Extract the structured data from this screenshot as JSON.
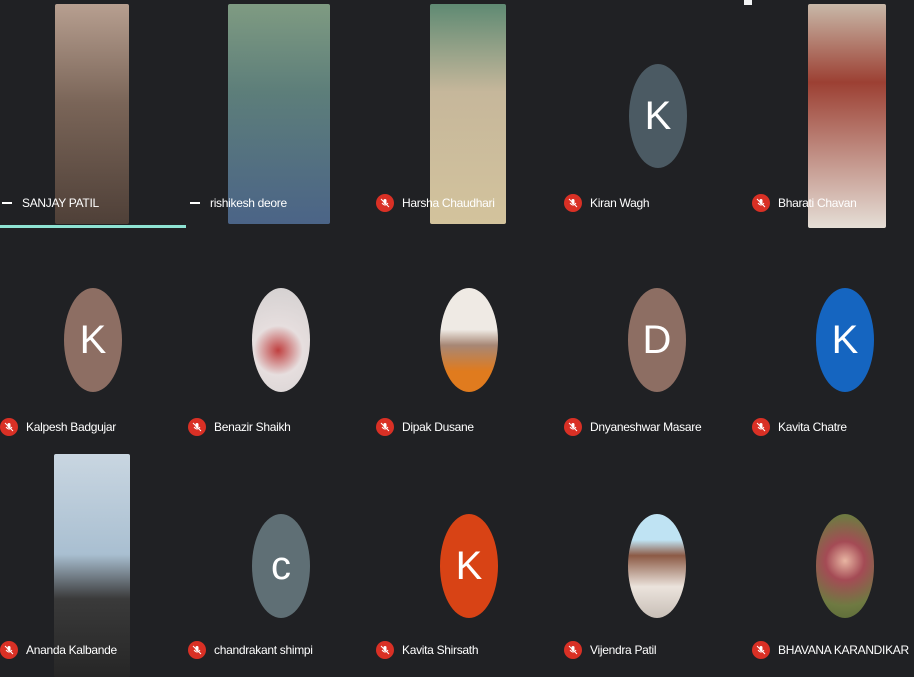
{
  "meeting": {
    "participants": [
      {
        "name": "SANJAY PATIL",
        "type": "video",
        "mic": "on",
        "bg": "#6b5a4f"
      },
      {
        "name": "rishikesh deore",
        "type": "video",
        "mic": "on",
        "bg": "#6b8a6a"
      },
      {
        "name": "Harsha Chaudhari",
        "type": "video",
        "mic": "muted",
        "bg": "#b9a98a"
      },
      {
        "name": "Kiran Wagh",
        "type": "letter",
        "letter": "K",
        "mic": "muted",
        "color": "#4b5a63"
      },
      {
        "name": "Bharati Chavan",
        "type": "video",
        "mic": "muted",
        "bg": "#9c4033"
      },
      {
        "name": "Kalpesh Badgujar",
        "type": "letter",
        "letter": "K",
        "mic": "muted",
        "color": "#8d6e63"
      },
      {
        "name": "Benazir Shaikh",
        "type": "photo",
        "mic": "muted",
        "color": "#d9d4d2"
      },
      {
        "name": "Dipak Dusane",
        "type": "photo",
        "mic": "muted",
        "color": "#e7e0d8"
      },
      {
        "name": "Dnyaneshwar Masare",
        "type": "letter",
        "letter": "D",
        "mic": "muted",
        "color": "#8d6e63"
      },
      {
        "name": "Kavita Chatre",
        "type": "letter",
        "letter": "K",
        "mic": "muted",
        "color": "#1565c0"
      },
      {
        "name": "Ananda Kalbande",
        "type": "video",
        "mic": "muted",
        "bg": "#a9bfd1"
      },
      {
        "name": "chandrakant shimpi",
        "type": "letter",
        "letter": "c",
        "mic": "muted",
        "color": "#5f6f75"
      },
      {
        "name": "Kavita Shirsath",
        "type": "letter",
        "letter": "K",
        "mic": "muted",
        "color": "#d84315"
      },
      {
        "name": "Vijendra Patil",
        "type": "photo",
        "mic": "muted",
        "color": "#bfe3f3"
      },
      {
        "name": "BHAVANA KARANDIKAR",
        "type": "photo",
        "mic": "muted",
        "color": "#c8c3b5"
      }
    ]
  }
}
